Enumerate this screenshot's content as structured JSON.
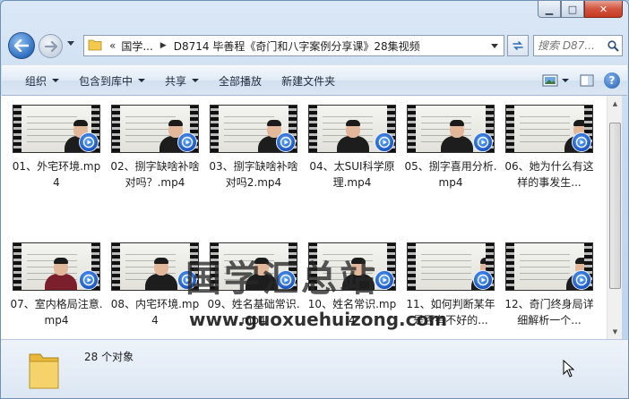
{
  "window": {
    "buttons": {
      "minimize": "▁",
      "maximize": "□",
      "close": "✕"
    }
  },
  "nav": {
    "crumbs": [
      "国学...",
      "D8714 毕善程《奇门和八字案例分享课》28集视频"
    ],
    "chevron": "«",
    "search_placeholder": "搜索 D87...",
    "icons": [
      "back-arrow-icon",
      "forward-arrow-icon",
      "folder-icon",
      "refresh-icon",
      "search-icon"
    ]
  },
  "toolbar": {
    "organize": "组织",
    "include_in_library": "包含到库中",
    "share": "共享",
    "play_all": "全部播放",
    "new_folder": "新建文件夹",
    "help": "?"
  },
  "files": [
    {
      "name": "01、外宅环境.mp4"
    },
    {
      "name": "02、捌字缺啥补啥对吗？.mp4"
    },
    {
      "name": "03、捌字缺啥补啥对吗2.mp4"
    },
    {
      "name": "04、太SUI科学原理.mp4"
    },
    {
      "name": "05、捌字喜用分析.mp4"
    },
    {
      "name": "06、她为什么有这样的事发生..."
    },
    {
      "name": "07、室内格局注意.mp4"
    },
    {
      "name": "08、内宅环境.mp4"
    },
    {
      "name": "09、姓名基础常识.mp4"
    },
    {
      "name": "10、姓名常识.mp4"
    },
    {
      "name": "11、如何判断某年是否有不好的..."
    },
    {
      "name": "12、奇门终身局详细解析一个..."
    }
  ],
  "watermark": {
    "cn": "国学汇总站",
    "en": "www.guoxuehuizong.com"
  },
  "details": {
    "count": "28 个对象"
  }
}
